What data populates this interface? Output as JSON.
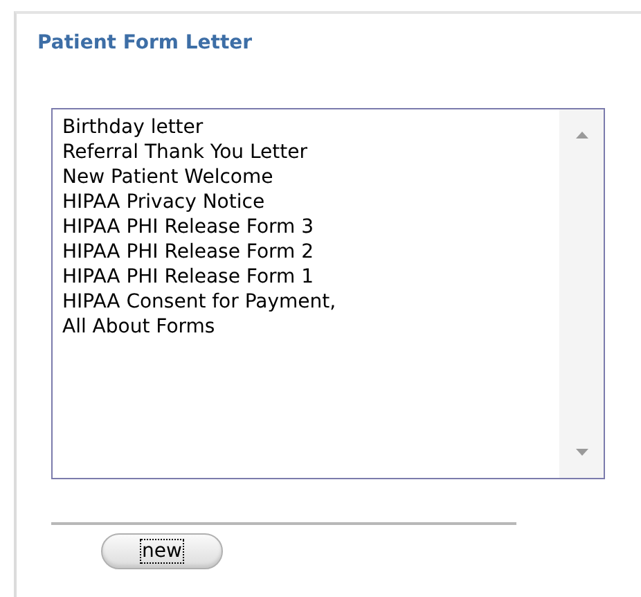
{
  "panel": {
    "title": "Patient Form Letter"
  },
  "letters": [
    {
      "label": "Birthday letter",
      "selected": false
    },
    {
      "label": "Referral Thank You Letter",
      "selected": false
    },
    {
      "label": "New Patient Welcome",
      "selected": false
    },
    {
      "label": "HIPAA Privacy Notice",
      "selected": false
    },
    {
      "label": "HIPAA PHI Release Form 3",
      "selected": false
    },
    {
      "label": "HIPAA PHI Release Form 2",
      "selected": false
    },
    {
      "label": "HIPAA PHI Release Form 1",
      "selected": false
    },
    {
      "label": "HIPAA Consent for Payment,",
      "selected": false
    },
    {
      "label": "All About Forms",
      "selected": false
    }
  ],
  "buttons": [
    {
      "label": "new",
      "focused": true
    }
  ]
}
